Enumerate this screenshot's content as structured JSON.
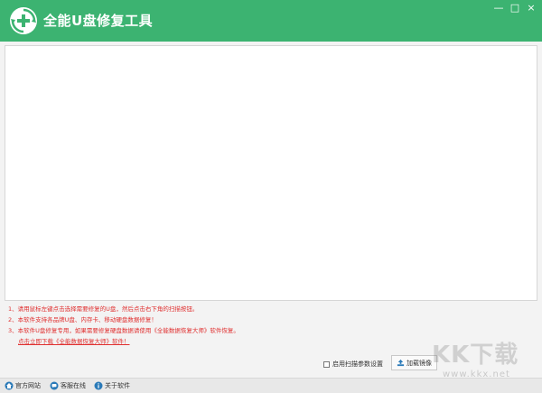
{
  "window": {
    "title": "全能U盘修复工具",
    "minimize": "—",
    "maximize": "□",
    "close": "×"
  },
  "icons": {
    "logo": "repair-plus-icon",
    "load": "upload-icon",
    "site": "home-icon",
    "service": "chat-icon",
    "about": "info-icon"
  },
  "instructions": {
    "line1": "1、请用鼠标左键点击选择需要修复的U盘，然后点击右下角的扫描按钮。",
    "line2": "2、本软件支持各品牌U盘、内存卡、移动硬盘数据修复！",
    "line3": "3、本软件U盘修复专用，如果需要修复硬盘数据请使用《全能数据恢复大师》软件恢复。",
    "link": "点击立即下载《全能数据恢复大师》软件！"
  },
  "options": {
    "scan_settings_label": "启用扫描参数设置",
    "scan_settings_checked": false,
    "load_image_button": "加载镜像"
  },
  "statusbar": {
    "site": "官方网站",
    "service": "客服在线",
    "about": "关于软件"
  },
  "watermark": {
    "brand": "KK下载",
    "url": "www.kkx.net"
  },
  "colors": {
    "titlebar": "#3cb371",
    "instruction_text": "#e03030"
  }
}
